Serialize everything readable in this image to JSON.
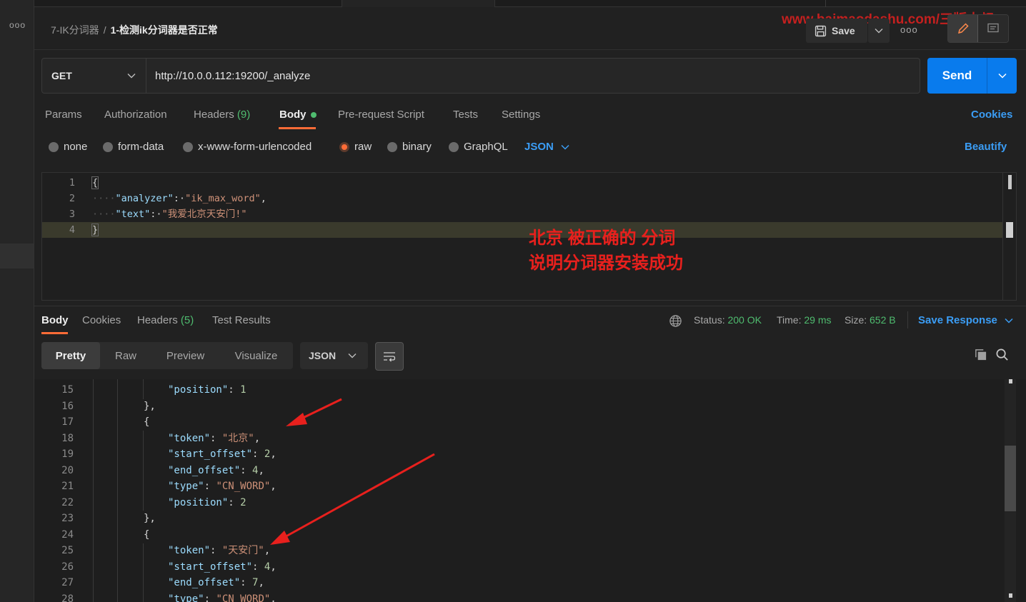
{
  "header": {
    "breadcrumb_collection": "7-IK分词器",
    "breadcrumb_separator": "/",
    "breadcrumb_request": "1-检测ik分词器是否正常",
    "watermark": "www.baimaodashu.com/三版大叔",
    "save_label": "Save",
    "more_label": "ooo"
  },
  "sidebar": {
    "more_label": "ooo"
  },
  "request": {
    "method": "GET",
    "url": "http://10.0.0.112:19200/_analyze",
    "send_label": "Send",
    "tabs": [
      {
        "label": "Params"
      },
      {
        "label": "Authorization"
      },
      {
        "label": "Headers",
        "count": "(9)"
      },
      {
        "label": "Body"
      },
      {
        "label": "Pre-request Script"
      },
      {
        "label": "Tests"
      },
      {
        "label": "Settings"
      }
    ],
    "cookies_label": "Cookies",
    "body_types": [
      "none",
      "form-data",
      "x-www-form-urlencoded",
      "raw",
      "binary",
      "GraphQL"
    ],
    "selected_body_type": "raw",
    "format": "JSON",
    "beautify_label": "Beautify",
    "accent_color": "#ff6c37",
    "send_color": "#097bed"
  },
  "editor": {
    "lines": [
      {
        "n": "1",
        "text": "{"
      },
      {
        "n": "2",
        "key": "\"analyzer\"",
        "value": "\"ik_max_word\""
      },
      {
        "n": "3",
        "key": "\"text\"",
        "value": "\"我爱北京天安门!\""
      },
      {
        "n": "4",
        "text": "}"
      }
    ]
  },
  "annotation": {
    "line1": "北京  被正确的 分词",
    "line2": "说明分词器安装成功",
    "color": "#e8201d"
  },
  "response": {
    "tabs": [
      {
        "label": "Body"
      },
      {
        "label": "Cookies"
      },
      {
        "label": "Headers",
        "count": "(5)"
      },
      {
        "label": "Test Results"
      }
    ],
    "status_label": "Status:",
    "status_value": "200 OK",
    "time_label": "Time:",
    "time_value": "29 ms",
    "size_label": "Size:",
    "size_value": "652 B",
    "save_response_label": "Save Response",
    "view_modes": [
      "Pretty",
      "Raw",
      "Preview",
      "Visualize"
    ],
    "selected_view": "Pretty",
    "format": "JSON",
    "lines": [
      {
        "n": "15",
        "indent": 3,
        "key": "\"position\"",
        "value": "1",
        "vtype": "num",
        "trail": ""
      },
      {
        "n": "16",
        "indent": 2,
        "text": "},"
      },
      {
        "n": "17",
        "indent": 2,
        "text": "{"
      },
      {
        "n": "18",
        "indent": 3,
        "key": "\"token\"",
        "value": "\"北京\"",
        "vtype": "str",
        "trail": ","
      },
      {
        "n": "19",
        "indent": 3,
        "key": "\"start_offset\"",
        "value": "2",
        "vtype": "num",
        "trail": ","
      },
      {
        "n": "20",
        "indent": 3,
        "key": "\"end_offset\"",
        "value": "4",
        "vtype": "num",
        "trail": ","
      },
      {
        "n": "21",
        "indent": 3,
        "key": "\"type\"",
        "value": "\"CN_WORD\"",
        "vtype": "str",
        "trail": ","
      },
      {
        "n": "22",
        "indent": 3,
        "key": "\"position\"",
        "value": "2",
        "vtype": "num",
        "trail": ""
      },
      {
        "n": "23",
        "indent": 2,
        "text": "},"
      },
      {
        "n": "24",
        "indent": 2,
        "text": "{"
      },
      {
        "n": "25",
        "indent": 3,
        "key": "\"token\"",
        "value": "\"天安门\"",
        "vtype": "str",
        "trail": ","
      },
      {
        "n": "26",
        "indent": 3,
        "key": "\"start_offset\"",
        "value": "4",
        "vtype": "num",
        "trail": ","
      },
      {
        "n": "27",
        "indent": 3,
        "key": "\"end_offset\"",
        "value": "7",
        "vtype": "num",
        "trail": ","
      },
      {
        "n": "28",
        "indent": 3,
        "key": "\"type\"",
        "value": "\"CN_WORD\"",
        "vtype": "str",
        "trail": ","
      }
    ]
  }
}
